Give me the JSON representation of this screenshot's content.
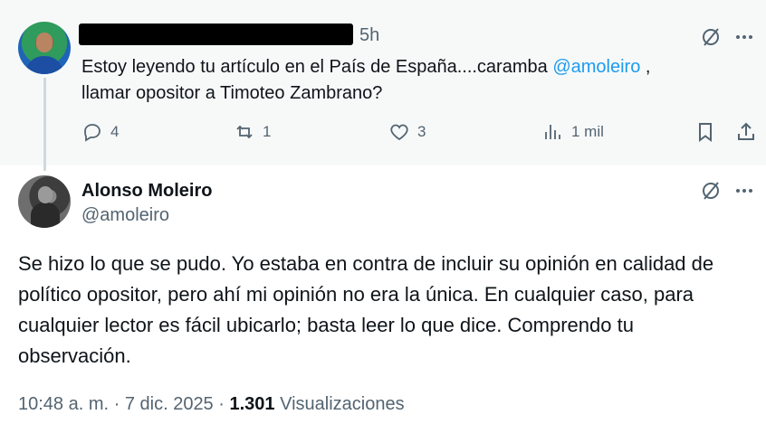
{
  "parent_tweet": {
    "time": "5h",
    "text_before": "Estoy leyendo tu artículo en el País de España....caramba ",
    "mention": "@amoleiro",
    "text_after": " ,\nllamar opositor a Timoteo Zambrano?",
    "actions": {
      "replies": "4",
      "retweets": "1",
      "likes": "3",
      "views": "1 mil"
    }
  },
  "reply_tweet": {
    "name": "Alonso Moleiro",
    "handle": "@amoleiro",
    "text": "Se hizo lo que se pudo. Yo estaba en contra de incluir su opinión en calidad de político opositor, pero ahí mi opinión no era la única. En cualquier caso, para cualquier lector es fácil ubicarlo; basta leer lo que dice. Comprendo tu observación.",
    "timestamp": "10:48 a. m. · 7 dic. 2025 · ",
    "views_count": "1.301",
    "views_label": " Visualizaciones"
  },
  "icons": {
    "grok": "grok-slash-icon",
    "more": "more-icon",
    "reply": "reply-icon",
    "retweet": "retweet-icon",
    "like": "heart-icon",
    "views": "views-icon",
    "bookmark": "bookmark-icon",
    "share": "share-icon"
  },
  "colors": {
    "accent": "#1d9bf0",
    "muted": "#536471",
    "text": "#0f1419",
    "parent_bg": "#f7f9f9"
  }
}
